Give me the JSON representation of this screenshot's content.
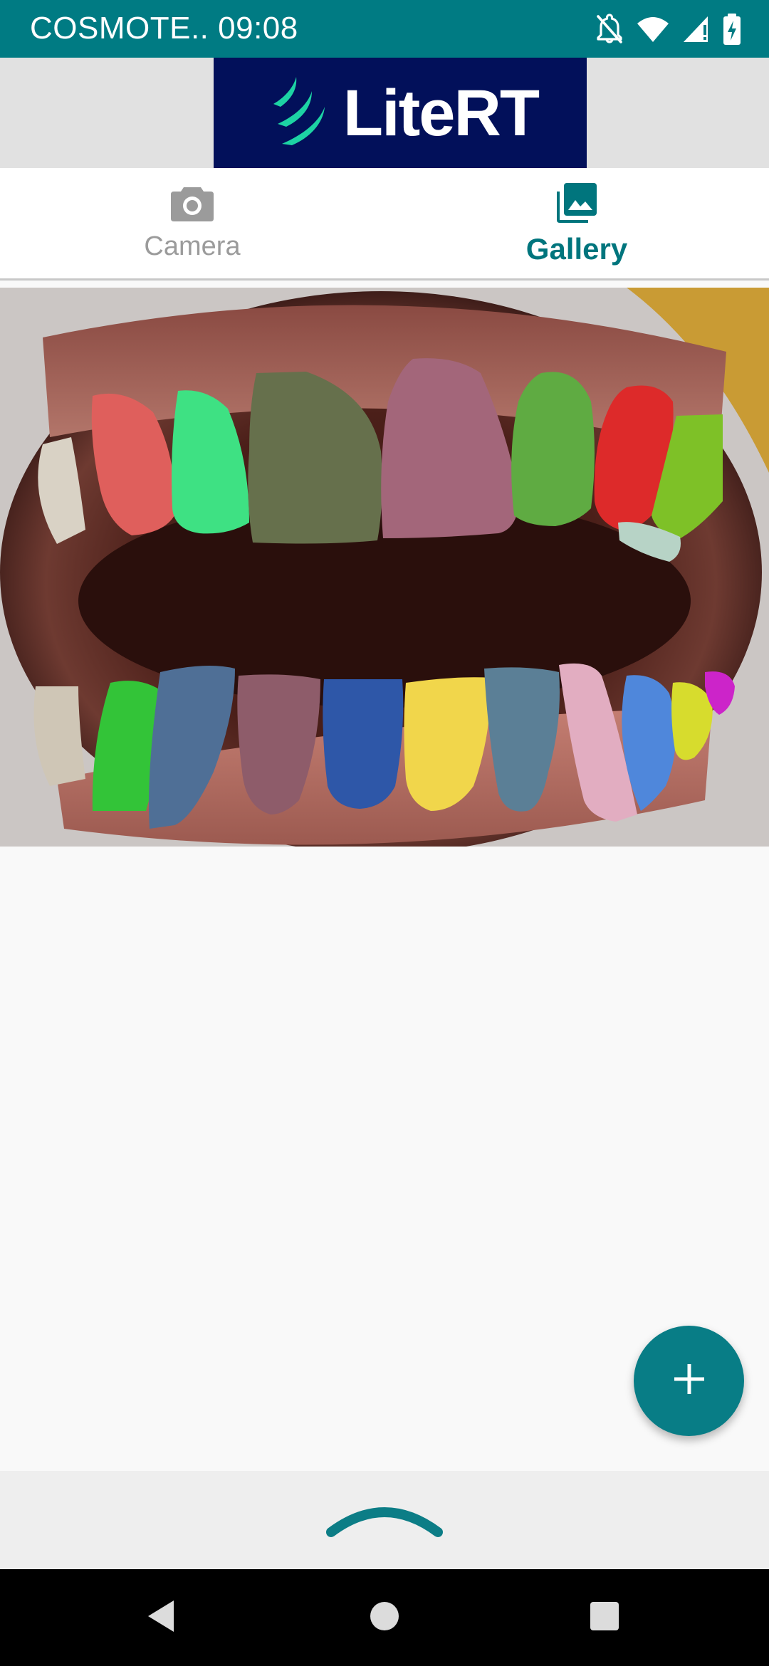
{
  "status_bar": {
    "carrier_time": "COSMOTE.. 09:08",
    "icons": [
      "notifications-off-icon",
      "wifi-icon",
      "signal-icon",
      "battery-charging-icon"
    ]
  },
  "header": {
    "logo_text": "LiteRT",
    "logo_icon": "literT-logo-icon",
    "background_color": "#02105a"
  },
  "tabs": [
    {
      "label": "Camera",
      "icon": "camera-icon",
      "selected": false
    },
    {
      "label": "Gallery",
      "icon": "image-icon",
      "selected": true
    }
  ],
  "result_image": {
    "content": "segmentation-overlay"
  },
  "fab": {
    "icon": "plus-icon",
    "color": "#087d86"
  },
  "bottom_sheet": {
    "icon": "chevron-up-icon"
  },
  "nav_bar": {
    "icons": [
      "back-icon",
      "home-icon",
      "recents-icon"
    ]
  },
  "colors": {
    "primary": "#007b83",
    "accent": "#00757d",
    "inactive": "#9b9b9b"
  }
}
